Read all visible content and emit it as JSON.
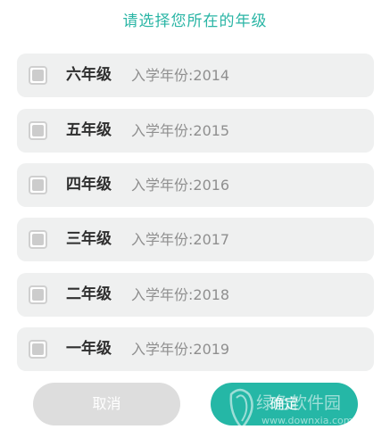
{
  "dialog": {
    "title": "请选择您所在的年级"
  },
  "grades": [
    {
      "name": "六年级",
      "year": "入学年份:2014",
      "checked": false
    },
    {
      "name": "五年级",
      "year": "入学年份:2015",
      "checked": false
    },
    {
      "name": "四年级",
      "year": "入学年份:2016",
      "checked": false
    },
    {
      "name": "三年级",
      "year": "入学年份:2017",
      "checked": false
    },
    {
      "name": "二年级",
      "year": "入学年份:2018",
      "checked": false
    },
    {
      "name": "一年级",
      "year": "入学年份:2019",
      "checked": false
    }
  ],
  "buttons": {
    "cancel_label": "取消",
    "confirm_label": "确定"
  },
  "watermark": {
    "text": "绿色软件园",
    "url": "www.downxia.com"
  },
  "colors": {
    "accent": "#2ab5a5",
    "confirm_bg": "#25b7a6",
    "cancel_bg": "#dddddd",
    "row_bg": "#eff0f0"
  }
}
